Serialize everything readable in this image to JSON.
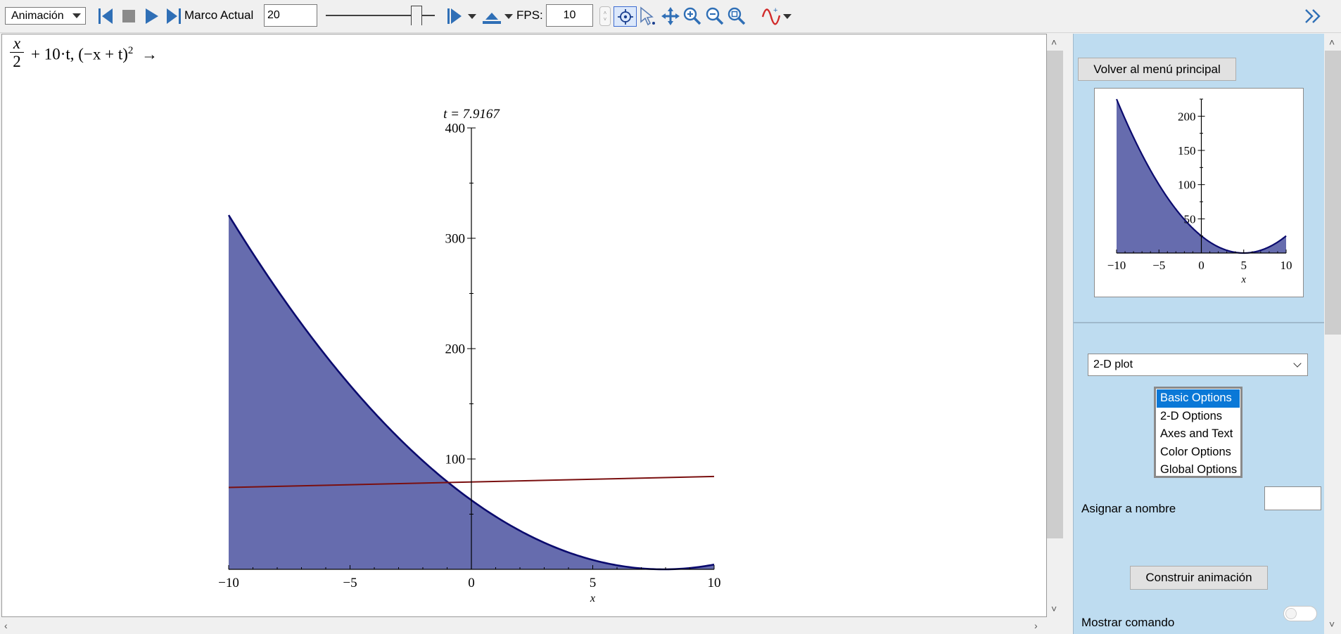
{
  "toolbar": {
    "mode_select": "Animación",
    "frame_label": "Marco Actual",
    "frame_value": "20",
    "fps_label": "FPS:",
    "fps_value": "10"
  },
  "worksheet": {
    "expression_x_numerator": "x",
    "expression_x_denominator": "2",
    "expression_rest": "+ 10·t, (−x + t)",
    "expression_power": "2",
    "expression_arrow": "→"
  },
  "panel": {
    "back_button": "Volver al menú principal",
    "plot_type": "2-D plot",
    "options": [
      "Basic Options",
      "2-D Options",
      "Axes and Text",
      "Color Options",
      "Global Options"
    ],
    "selected_option": "Basic Options",
    "assign_name_label": "Asignar a nombre",
    "build_button": "Construir animación",
    "show_command_label": "Mostrar comando"
  },
  "colors": {
    "fill": "#666cae",
    "curve": "#0b0b6e",
    "line": "#7a0f0f",
    "selection": "#0a78d7",
    "panel_bg": "#bedcf0"
  },
  "chart_data": [
    {
      "type": "area",
      "title": "t = 7.9167",
      "xlabel": "x",
      "ylabel": "",
      "xlim": [
        -10,
        10
      ],
      "ylim": [
        0,
        400
      ],
      "xticks": [
        "−10",
        "−5",
        "0",
        "5",
        "10"
      ],
      "yticks": [
        "100",
        "200",
        "300",
        "400"
      ],
      "series": [
        {
          "values": [
            {
              "x": -10,
              "y": 320.05
            },
            {
              "x": -5,
              "y": 166.3
            },
            {
              "x": 0,
              "y": 62.67
            },
            {
              "x": 5,
              "y": 8.5
            },
            {
              "x": 7.9167,
              "y": 0
            },
            {
              "x": 10,
              "y": 4.34
            }
          ]
        },
        {
          "values": [
            {
              "x": -10,
              "y": 74.17
            },
            {
              "x": 0,
              "y": 79.17
            },
            {
              "x": 10,
              "y": 84.17
            }
          ]
        }
      ]
    },
    {
      "type": "area",
      "title": "",
      "xlabel": "x",
      "ylabel": "",
      "xlim": [
        -10,
        10
      ],
      "ylim": [
        0,
        225
      ],
      "xticks": [
        "−10",
        "−5",
        "0",
        "5",
        "10"
      ],
      "yticks": [
        "50",
        "100",
        "150",
        "200"
      ],
      "series": [
        {
          "values": [
            {
              "x": -10,
              "y": 225
            },
            {
              "x": 0,
              "y": 25
            },
            {
              "x": 5,
              "y": 0
            },
            {
              "x": 10,
              "y": 25
            }
          ]
        }
      ]
    }
  ]
}
